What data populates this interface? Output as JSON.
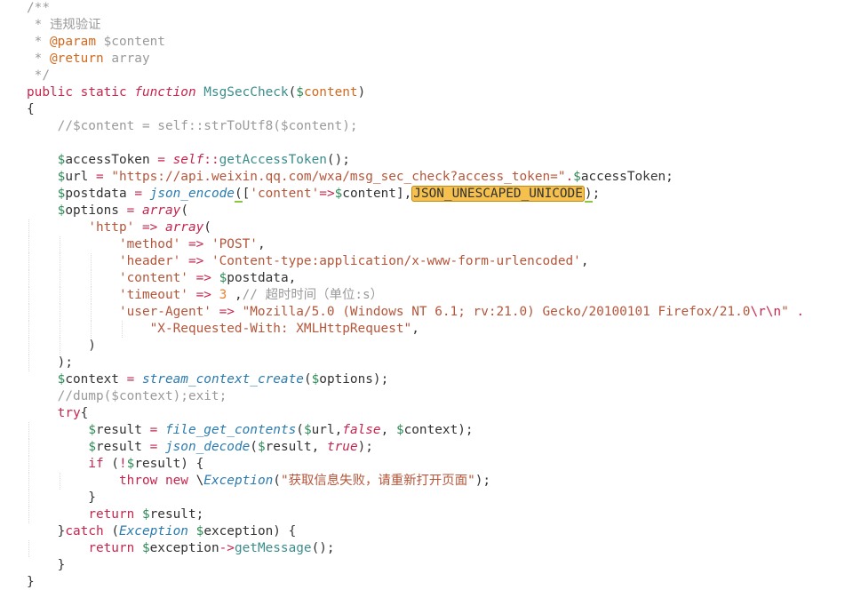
{
  "editor": {
    "lines": [
      [
        {
          "t": "/**",
          "c": "c"
        }
      ],
      [
        {
          "t": " * 违规验证",
          "c": "c"
        }
      ],
      [
        {
          "t": " * ",
          "c": "c"
        },
        {
          "t": "@param",
          "c": "dt"
        },
        {
          "t": " $content",
          "c": "c"
        }
      ],
      [
        {
          "t": " * ",
          "c": "c"
        },
        {
          "t": "@return",
          "c": "dt"
        },
        {
          "t": " array",
          "c": "c"
        }
      ],
      [
        {
          "t": " */",
          "c": "c"
        }
      ],
      [
        {
          "t": "public",
          "c": "k"
        },
        {
          "t": " ",
          "c": "p"
        },
        {
          "t": "static",
          "c": "k"
        },
        {
          "t": " ",
          "c": "p"
        },
        {
          "t": "function",
          "c": "ki"
        },
        {
          "t": " ",
          "c": "p"
        },
        {
          "t": "MsgSecCheck",
          "c": "f"
        },
        {
          "t": "(",
          "c": "p"
        },
        {
          "t": "$",
          "c": "d"
        },
        {
          "t": "content",
          "c": "dt"
        },
        {
          "t": ")",
          "c": "p"
        }
      ],
      [
        {
          "t": "{",
          "c": "p"
        }
      ],
      [
        {
          "t": "    //$content = self::strToUtf8($content);",
          "c": "c"
        }
      ],
      [],
      [
        {
          "t": "    ",
          "c": "p"
        },
        {
          "t": "$",
          "c": "d"
        },
        {
          "t": "accessToken ",
          "c": "v"
        },
        {
          "t": "=",
          "c": "o"
        },
        {
          "t": " ",
          "c": "p"
        },
        {
          "t": "self",
          "c": "ki"
        },
        {
          "t": "::",
          "c": "o"
        },
        {
          "t": "getAccessToken",
          "c": "f"
        },
        {
          "t": "();",
          "c": "p"
        }
      ],
      [
        {
          "t": "    ",
          "c": "p"
        },
        {
          "t": "$",
          "c": "d"
        },
        {
          "t": "url ",
          "c": "v"
        },
        {
          "t": "=",
          "c": "o"
        },
        {
          "t": " ",
          "c": "p"
        },
        {
          "t": "\"https://api.weixin.qq.com/wxa/msg_sec_check?access_token=\"",
          "c": "s"
        },
        {
          "t": ".",
          "c": "o"
        },
        {
          "t": "$",
          "c": "d"
        },
        {
          "t": "accessToken;",
          "c": "v"
        }
      ],
      [
        {
          "t": "    ",
          "c": "p"
        },
        {
          "t": "$",
          "c": "d"
        },
        {
          "t": "postdata ",
          "c": "v"
        },
        {
          "t": "=",
          "c": "o"
        },
        {
          "t": " ",
          "c": "p"
        },
        {
          "t": "json_encode",
          "c": "fi"
        },
        {
          "t": "(",
          "c": "ul"
        },
        {
          "t": "[",
          "c": "p"
        },
        {
          "t": "'content'",
          "c": "s"
        },
        {
          "t": "=>",
          "c": "o"
        },
        {
          "t": "$",
          "c": "d"
        },
        {
          "t": "content],",
          "c": "v"
        },
        {
          "t": "JSON_UNESCAPED_UNICODE",
          "c": "hl"
        },
        {
          "t": ")",
          "c": "ul"
        },
        {
          "t": ";",
          "c": "p"
        }
      ],
      [
        {
          "t": "    ",
          "c": "p"
        },
        {
          "t": "$",
          "c": "d"
        },
        {
          "t": "options ",
          "c": "v"
        },
        {
          "t": "=",
          "c": "o"
        },
        {
          "t": " ",
          "c": "p"
        },
        {
          "t": "array",
          "c": "ki"
        },
        {
          "t": "(",
          "c": "p"
        }
      ],
      [
        {
          "t": "        ",
          "c": "p"
        },
        {
          "t": "'http'",
          "c": "s"
        },
        {
          "t": " ",
          "c": "p"
        },
        {
          "t": "=>",
          "c": "o"
        },
        {
          "t": " ",
          "c": "p"
        },
        {
          "t": "array",
          "c": "ki"
        },
        {
          "t": "(",
          "c": "p"
        }
      ],
      [
        {
          "t": "            ",
          "c": "p"
        },
        {
          "t": "'method'",
          "c": "s"
        },
        {
          "t": " ",
          "c": "p"
        },
        {
          "t": "=>",
          "c": "o"
        },
        {
          "t": " ",
          "c": "p"
        },
        {
          "t": "'POST'",
          "c": "s"
        },
        {
          "t": ",",
          "c": "p"
        }
      ],
      [
        {
          "t": "            ",
          "c": "p"
        },
        {
          "t": "'header'",
          "c": "s"
        },
        {
          "t": " ",
          "c": "p"
        },
        {
          "t": "=>",
          "c": "o"
        },
        {
          "t": " ",
          "c": "p"
        },
        {
          "t": "'Content-type:application/x-www-form-urlencoded'",
          "c": "s"
        },
        {
          "t": ",",
          "c": "p"
        }
      ],
      [
        {
          "t": "            ",
          "c": "p"
        },
        {
          "t": "'content'",
          "c": "s"
        },
        {
          "t": " ",
          "c": "p"
        },
        {
          "t": "=>",
          "c": "o"
        },
        {
          "t": " ",
          "c": "p"
        },
        {
          "t": "$",
          "c": "d"
        },
        {
          "t": "postdata,",
          "c": "v"
        }
      ],
      [
        {
          "t": "            ",
          "c": "p"
        },
        {
          "t": "'timeout'",
          "c": "s"
        },
        {
          "t": " ",
          "c": "p"
        },
        {
          "t": "=>",
          "c": "o"
        },
        {
          "t": " ",
          "c": "p"
        },
        {
          "t": "3",
          "c": "n"
        },
        {
          "t": " ,",
          "c": "p"
        },
        {
          "t": "// 超时时间（单位:s）",
          "c": "c"
        }
      ],
      [
        {
          "t": "            ",
          "c": "p"
        },
        {
          "t": "'user-Agent'",
          "c": "s"
        },
        {
          "t": " ",
          "c": "p"
        },
        {
          "t": "=>",
          "c": "o"
        },
        {
          "t": " ",
          "c": "p"
        },
        {
          "t": "\"Mozilla/5.0 (Windows NT 6.1; rv:21.0) Gecko/20100101 Firefox/21.0",
          "c": "s"
        },
        {
          "t": "\\r\\n",
          "c": "o"
        },
        {
          "t": "\"",
          "c": "s"
        },
        {
          "t": " .",
          "c": "o"
        }
      ],
      [
        {
          "t": "                ",
          "c": "p"
        },
        {
          "t": "\"X-Requested-With: XMLHttpRequest\"",
          "c": "s"
        },
        {
          "t": ",",
          "c": "p"
        }
      ],
      [
        {
          "t": "        )",
          "c": "p"
        }
      ],
      [
        {
          "t": "    );",
          "c": "p"
        }
      ],
      [
        {
          "t": "    ",
          "c": "p"
        },
        {
          "t": "$",
          "c": "d"
        },
        {
          "t": "context ",
          "c": "v"
        },
        {
          "t": "=",
          "c": "o"
        },
        {
          "t": " ",
          "c": "p"
        },
        {
          "t": "stream_context_create",
          "c": "fi"
        },
        {
          "t": "(",
          "c": "p"
        },
        {
          "t": "$",
          "c": "d"
        },
        {
          "t": "options);",
          "c": "v"
        }
      ],
      [
        {
          "t": "    //dump($context);exit;",
          "c": "c"
        }
      ],
      [
        {
          "t": "    ",
          "c": "p"
        },
        {
          "t": "try",
          "c": "k"
        },
        {
          "t": "{",
          "c": "p"
        }
      ],
      [
        {
          "t": "        ",
          "c": "p"
        },
        {
          "t": "$",
          "c": "d"
        },
        {
          "t": "result ",
          "c": "v"
        },
        {
          "t": "=",
          "c": "o"
        },
        {
          "t": " ",
          "c": "p"
        },
        {
          "t": "file_get_contents",
          "c": "fi"
        },
        {
          "t": "(",
          "c": "p"
        },
        {
          "t": "$",
          "c": "d"
        },
        {
          "t": "url,",
          "c": "v"
        },
        {
          "t": "false",
          "c": "ki"
        },
        {
          "t": ", ",
          "c": "p"
        },
        {
          "t": "$",
          "c": "d"
        },
        {
          "t": "context);",
          "c": "v"
        }
      ],
      [
        {
          "t": "        ",
          "c": "p"
        },
        {
          "t": "$",
          "c": "d"
        },
        {
          "t": "result ",
          "c": "v"
        },
        {
          "t": "=",
          "c": "o"
        },
        {
          "t": " ",
          "c": "p"
        },
        {
          "t": "json_decode",
          "c": "fi"
        },
        {
          "t": "(",
          "c": "p"
        },
        {
          "t": "$",
          "c": "d"
        },
        {
          "t": "result, ",
          "c": "v"
        },
        {
          "t": "true",
          "c": "ki"
        },
        {
          "t": ");",
          "c": "p"
        }
      ],
      [
        {
          "t": "        ",
          "c": "p"
        },
        {
          "t": "if",
          "c": "k"
        },
        {
          "t": " (",
          "c": "p"
        },
        {
          "t": "!",
          "c": "o"
        },
        {
          "t": "$",
          "c": "d"
        },
        {
          "t": "result) {",
          "c": "v"
        }
      ],
      [
        {
          "t": "            ",
          "c": "p"
        },
        {
          "t": "throw",
          "c": "k"
        },
        {
          "t": " ",
          "c": "p"
        },
        {
          "t": "new",
          "c": "k"
        },
        {
          "t": " \\",
          "c": "p"
        },
        {
          "t": "Exception",
          "c": "ci"
        },
        {
          "t": "(",
          "c": "p"
        },
        {
          "t": "\"获取信息失败，请重新打开页面\"",
          "c": "s"
        },
        {
          "t": ");",
          "c": "p"
        }
      ],
      [
        {
          "t": "        }",
          "c": "p"
        }
      ],
      [
        {
          "t": "        ",
          "c": "p"
        },
        {
          "t": "return",
          "c": "k"
        },
        {
          "t": " ",
          "c": "p"
        },
        {
          "t": "$",
          "c": "d"
        },
        {
          "t": "result;",
          "c": "v"
        }
      ],
      [
        {
          "t": "    }",
          "c": "p"
        },
        {
          "t": "catch",
          "c": "k"
        },
        {
          "t": " (",
          "c": "p"
        },
        {
          "t": "Exception",
          "c": "ci"
        },
        {
          "t": " ",
          "c": "p"
        },
        {
          "t": "$",
          "c": "d"
        },
        {
          "t": "exception) {",
          "c": "v"
        }
      ],
      [
        {
          "t": "        ",
          "c": "p"
        },
        {
          "t": "return",
          "c": "k"
        },
        {
          "t": " ",
          "c": "p"
        },
        {
          "t": "$",
          "c": "d"
        },
        {
          "t": "exception",
          "c": "v"
        },
        {
          "t": "->",
          "c": "o"
        },
        {
          "t": "getMessage",
          "c": "f"
        },
        {
          "t": "();",
          "c": "p"
        }
      ],
      [
        {
          "t": "    }",
          "c": "p"
        }
      ],
      [
        {
          "t": "}",
          "c": "p"
        }
      ]
    ]
  }
}
